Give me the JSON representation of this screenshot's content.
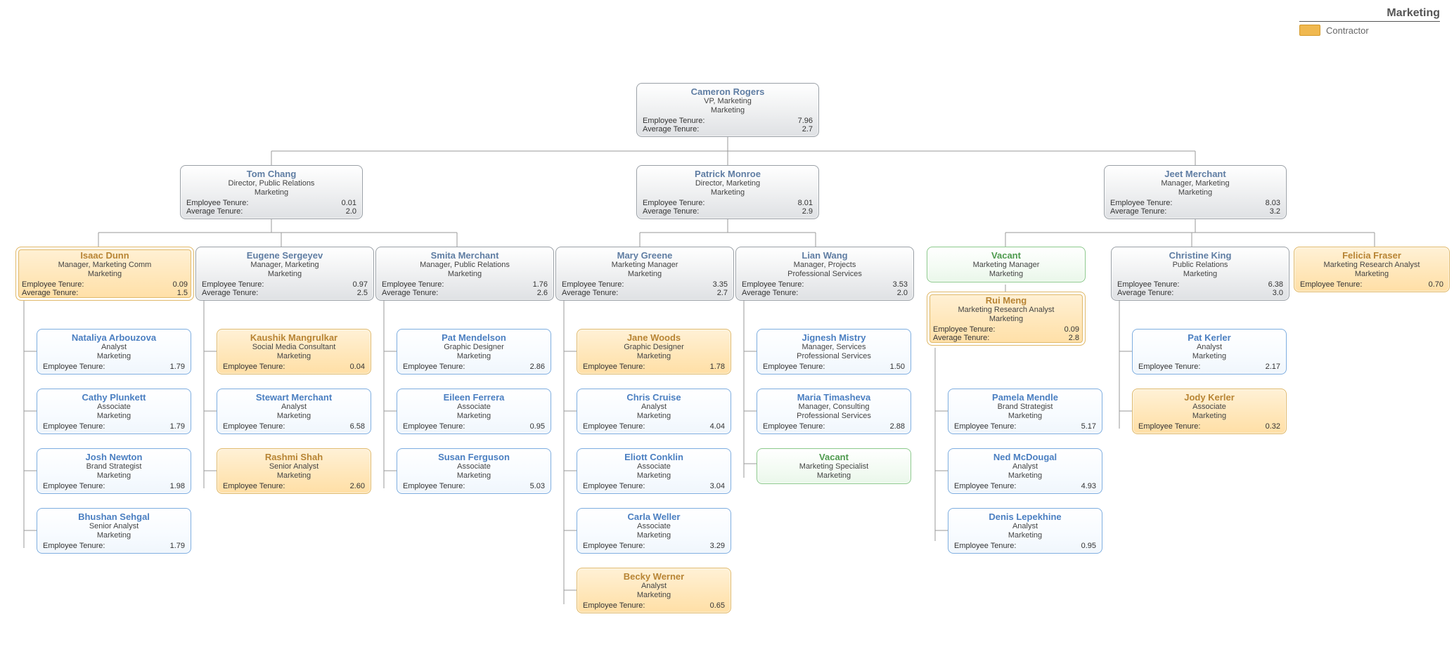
{
  "legend": {
    "title": "Marketing",
    "contractor": "Contractor"
  },
  "labels": {
    "emp": "Employee Tenure:",
    "avg": "Average Tenure:"
  },
  "nodes": {
    "root": {
      "name": "Cameron Rogers",
      "title": "VP, Marketing",
      "dept": "Marketing",
      "emp": "7.96",
      "avg": "2.7"
    },
    "tom": {
      "name": "Tom Chang",
      "title": "Director, Public Relations",
      "dept": "Marketing",
      "emp": "0.01",
      "avg": "2.0"
    },
    "patrick": {
      "name": "Patrick Monroe",
      "title": "Director, Marketing",
      "dept": "Marketing",
      "emp": "8.01",
      "avg": "2.9"
    },
    "jeet": {
      "name": "Jeet Merchant",
      "title": "Manager, Marketing",
      "dept": "Marketing",
      "emp": "8.03",
      "avg": "3.2"
    },
    "isaac": {
      "name": "Isaac Dunn",
      "title": "Manager, Marketing Comm",
      "dept": "Marketing",
      "emp": "0.09",
      "avg": "1.5"
    },
    "eugene": {
      "name": "Eugene Sergeyev",
      "title": "Manager, Marketing",
      "dept": "Marketing",
      "emp": "0.97",
      "avg": "2.5"
    },
    "smita": {
      "name": "Smita Merchant",
      "title": "Manager, Public Relations",
      "dept": "Marketing",
      "emp": "1.76",
      "avg": "2.6"
    },
    "mary": {
      "name": "Mary Greene",
      "title": "Marketing Manager",
      "dept": "Marketing",
      "emp": "3.35",
      "avg": "2.7"
    },
    "lian": {
      "name": "Lian Wang",
      "title": "Manager, Projects",
      "dept": "Professional Services",
      "emp": "3.53",
      "avg": "2.0"
    },
    "vacmm": {
      "name": "Vacant",
      "title": "Marketing Manager",
      "dept": "Marketing"
    },
    "christine": {
      "name": "Christine King",
      "title": "Public Relations",
      "dept": "Marketing",
      "emp": "6.38",
      "avg": "3.0"
    },
    "felicia": {
      "name": "Felicia Fraser",
      "title": "Marketing Research Analyst",
      "dept": "Marketing",
      "emp": "0.70"
    },
    "rui": {
      "name": "Rui Meng",
      "title": "Marketing Research Analyst",
      "dept": "Marketing",
      "emp": "0.09",
      "avg": "2.8"
    },
    "nataliya": {
      "name": "Nataliya Arbouzova",
      "title": "Analyst",
      "dept": "Marketing",
      "emp": "1.79"
    },
    "cathy": {
      "name": "Cathy Plunkett",
      "title": "Associate",
      "dept": "Marketing",
      "emp": "1.79"
    },
    "josh": {
      "name": "Josh Newton",
      "title": "Brand Strategist",
      "dept": "Marketing",
      "emp": "1.98"
    },
    "bhushan": {
      "name": "Bhushan Sehgal",
      "title": "Senior Analyst",
      "dept": "Marketing",
      "emp": "1.79"
    },
    "kaushik": {
      "name": "Kaushik Mangrulkar",
      "title": "Social Media Consultant",
      "dept": "Marketing",
      "emp": "0.04"
    },
    "stewart": {
      "name": "Stewart Merchant",
      "title": "Analyst",
      "dept": "Marketing",
      "emp": "6.58"
    },
    "rashmi": {
      "name": "Rashmi Shah",
      "title": "Senior Analyst",
      "dept": "Marketing",
      "emp": "2.60"
    },
    "patm": {
      "name": "Pat Mendelson",
      "title": "Graphic Designer",
      "dept": "Marketing",
      "emp": "2.86"
    },
    "eileen": {
      "name": "Eileen Ferrera",
      "title": "Associate",
      "dept": "Marketing",
      "emp": "0.95"
    },
    "susan": {
      "name": "Susan Ferguson",
      "title": "Associate",
      "dept": "Marketing",
      "emp": "5.03"
    },
    "jane": {
      "name": "Jane Woods",
      "title": "Graphic Designer",
      "dept": "Marketing",
      "emp": "1.78"
    },
    "chris": {
      "name": "Chris Cruise",
      "title": "Analyst",
      "dept": "Marketing",
      "emp": "4.04"
    },
    "eliott": {
      "name": "Eliott Conklin",
      "title": "Associate",
      "dept": "Marketing",
      "emp": "3.04"
    },
    "carla": {
      "name": "Carla Weller",
      "title": "Associate",
      "dept": "Marketing",
      "emp": "3.29"
    },
    "becky": {
      "name": "Becky Werner",
      "title": "Analyst",
      "dept": "Marketing",
      "emp": "0.65"
    },
    "jignesh": {
      "name": "Jignesh Mistry",
      "title": "Manager, Services",
      "dept": "Professional Services",
      "emp": "1.50"
    },
    "maria": {
      "name": "Maria Timasheva",
      "title": "Manager, Consulting",
      "dept": "Professional Services",
      "emp": "2.88"
    },
    "vacms": {
      "name": "Vacant",
      "title": "Marketing Specialist",
      "dept": "Marketing"
    },
    "pamela": {
      "name": "Pamela Mendle",
      "title": "Brand Strategist",
      "dept": "Marketing",
      "emp": "5.17"
    },
    "ned": {
      "name": "Ned McDougal",
      "title": "Analyst",
      "dept": "Marketing",
      "emp": "4.93"
    },
    "denis": {
      "name": "Denis Lepekhine",
      "title": "Analyst",
      "dept": "Marketing",
      "emp": "0.95"
    },
    "patk": {
      "name": "Pat Kerler",
      "title": "Analyst",
      "dept": "Marketing",
      "emp": "2.17"
    },
    "jody": {
      "name": "Jody Kerler",
      "title": "Associate",
      "dept": "Marketing",
      "emp": "0.32"
    }
  }
}
